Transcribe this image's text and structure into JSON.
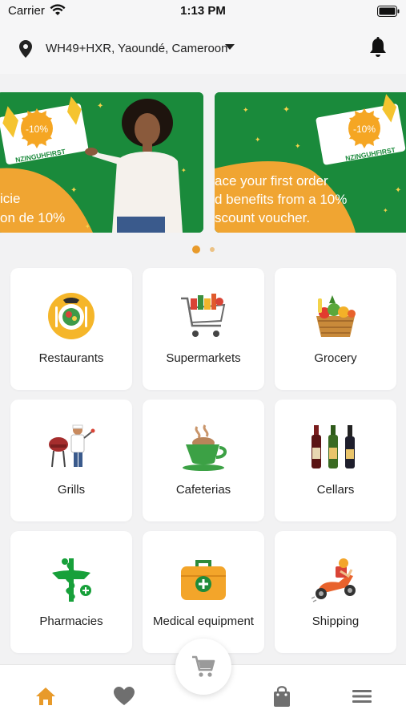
{
  "status_bar": {
    "carrier": "Carrier",
    "time": "1:13 PM"
  },
  "location": {
    "address": "WH49+HXR, Yaoundé, Cameroon"
  },
  "banners": [
    {
      "badge": "-10%",
      "code": "NZINGUHFIRST",
      "line1": "icie",
      "line2": "on de 10%"
    },
    {
      "badge": "-10%",
      "code": "NZINGUHFIRST",
      "line1": "ace your first order",
      "line2": "d benefits from a 10%",
      "line3": "scount voucher."
    }
  ],
  "categories": [
    {
      "label": "Restaurants",
      "icon": "restaurant-icon"
    },
    {
      "label": "Supermarkets",
      "icon": "shopping-cart-icon"
    },
    {
      "label": "Grocery",
      "icon": "grocery-basket-icon"
    },
    {
      "label": "Grills",
      "icon": "grill-chef-icon"
    },
    {
      "label": "Cafeterias",
      "icon": "coffee-cup-icon"
    },
    {
      "label": "Cellars",
      "icon": "wine-bottles-icon"
    },
    {
      "label": "Pharmacies",
      "icon": "pharmacy-icon"
    },
    {
      "label": "Medical equipment",
      "icon": "medical-kit-icon"
    },
    {
      "label": "Shipping",
      "icon": "delivery-scooter-icon"
    }
  ],
  "bottom_nav": [
    "home-icon",
    "heart-icon",
    "cart-icon",
    "bag-icon",
    "menu-icon"
  ],
  "colors": {
    "accent": "#e89a2a",
    "brand_green": "#1a8a3b"
  }
}
